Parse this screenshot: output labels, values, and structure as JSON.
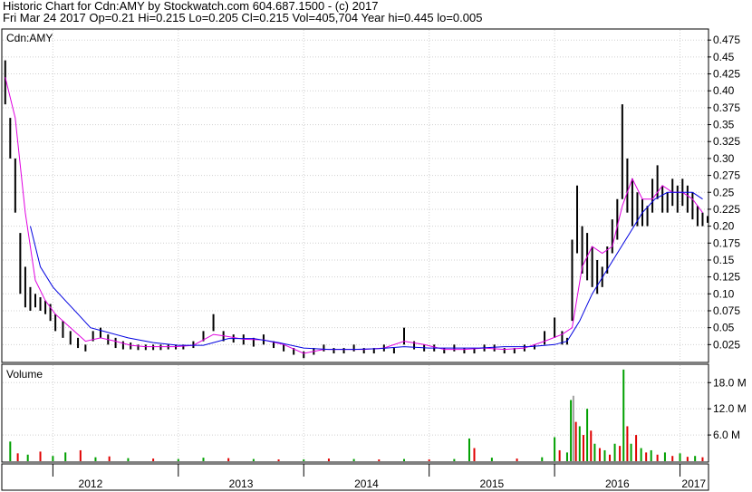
{
  "header": {
    "line1": "Historic Chart for Cdn:AMY by Stockwatch.com 604.687.1500 - (c) 2017",
    "line2": "Fri Mar 24 2017   Op=0.21  Hi=0.215  Lo=0.205  Cl=0.215  Vol=405,704   Year hi=0.445   lo=0.005"
  },
  "chart_data": [
    {
      "type": "line",
      "title": "Cdn:AMY",
      "xlim": [
        2011.6,
        2017.22
      ],
      "ylim": [
        0.0,
        0.49
      ],
      "y_ticks": [
        "0.475",
        "0.45",
        "0.425",
        "0.40",
        "0.375",
        "0.35",
        "0.325",
        "0.30",
        "0.275",
        "0.25",
        "0.225",
        "0.20",
        "0.175",
        "0.15",
        "0.125",
        "0.10",
        "0.075",
        "0.05",
        "0.025"
      ],
      "x_ticks": [
        "2012",
        "2013",
        "2014",
        "2015",
        "2016",
        "2017"
      ],
      "grid": true,
      "series": [
        {
          "style": "daily high-low bars",
          "color": "#000000",
          "x": [
            2011.62,
            2011.66,
            2011.7,
            2011.74,
            2011.78,
            2011.82,
            2011.86,
            2011.9,
            2011.94,
            2011.98,
            2012.02,
            2012.08,
            2012.14,
            2012.2,
            2012.26,
            2012.32,
            2012.38,
            2012.44,
            2012.5,
            2012.56,
            2012.62,
            2012.68,
            2012.74,
            2012.8,
            2012.86,
            2012.92,
            2012.98,
            2013.04,
            2013.12,
            2013.2,
            2013.28,
            2013.36,
            2013.44,
            2013.52,
            2013.6,
            2013.68,
            2013.76,
            2013.84,
            2013.92,
            2014.0,
            2014.08,
            2014.16,
            2014.24,
            2014.32,
            2014.4,
            2014.48,
            2014.56,
            2014.64,
            2014.72,
            2014.8,
            2014.88,
            2014.96,
            2015.04,
            2015.12,
            2015.2,
            2015.28,
            2015.36,
            2015.44,
            2015.52,
            2015.6,
            2015.68,
            2015.76,
            2015.84,
            2015.92,
            2016.0,
            2016.06,
            2016.1,
            2016.14,
            2016.18,
            2016.22,
            2016.26,
            2016.3,
            2016.34,
            2016.38,
            2016.42,
            2016.46,
            2016.5,
            2016.54,
            2016.58,
            2016.62,
            2016.66,
            2016.7,
            2016.74,
            2016.78,
            2016.82,
            2016.86,
            2016.9,
            2016.94,
            2016.98,
            2017.02,
            2017.06,
            2017.1,
            2017.14,
            2017.18,
            2017.22
          ],
          "high": [
            0.445,
            0.36,
            0.3,
            0.19,
            0.14,
            0.11,
            0.1,
            0.095,
            0.09,
            0.085,
            0.07,
            0.06,
            0.045,
            0.035,
            0.025,
            0.045,
            0.05,
            0.04,
            0.035,
            0.03,
            0.028,
            0.025,
            0.025,
            0.025,
            0.025,
            0.025,
            0.025,
            0.025,
            0.03,
            0.045,
            0.07,
            0.045,
            0.04,
            0.04,
            0.035,
            0.04,
            0.03,
            0.025,
            0.02,
            0.015,
            0.02,
            0.025,
            0.02,
            0.02,
            0.025,
            0.02,
            0.02,
            0.025,
            0.02,
            0.05,
            0.03,
            0.025,
            0.025,
            0.02,
            0.025,
            0.02,
            0.02,
            0.025,
            0.025,
            0.02,
            0.02,
            0.025,
            0.025,
            0.045,
            0.065,
            0.045,
            0.035,
            0.18,
            0.26,
            0.2,
            0.19,
            0.17,
            0.15,
            0.14,
            0.17,
            0.21,
            0.24,
            0.38,
            0.3,
            0.27,
            0.25,
            0.24,
            0.23,
            0.27,
            0.29,
            0.26,
            0.25,
            0.27,
            0.26,
            0.27,
            0.26,
            0.25,
            0.23,
            0.22,
            0.215
          ],
          "low": [
            0.38,
            0.3,
            0.22,
            0.1,
            0.08,
            0.075,
            0.08,
            0.075,
            0.07,
            0.06,
            0.045,
            0.035,
            0.025,
            0.02,
            0.015,
            0.03,
            0.035,
            0.025,
            0.02,
            0.018,
            0.018,
            0.017,
            0.017,
            0.017,
            0.017,
            0.018,
            0.018,
            0.018,
            0.02,
            0.03,
            0.045,
            0.03,
            0.028,
            0.025,
            0.022,
            0.025,
            0.02,
            0.015,
            0.01,
            0.005,
            0.01,
            0.015,
            0.012,
            0.012,
            0.015,
            0.012,
            0.012,
            0.015,
            0.012,
            0.025,
            0.018,
            0.015,
            0.015,
            0.012,
            0.015,
            0.012,
            0.012,
            0.015,
            0.015,
            0.012,
            0.012,
            0.015,
            0.018,
            0.025,
            0.035,
            0.025,
            0.025,
            0.06,
            0.16,
            0.13,
            0.12,
            0.11,
            0.1,
            0.11,
            0.13,
            0.16,
            0.18,
            0.24,
            0.22,
            0.2,
            0.2,
            0.2,
            0.2,
            0.22,
            0.24,
            0.22,
            0.22,
            0.23,
            0.22,
            0.23,
            0.22,
            0.21,
            0.2,
            0.2,
            0.205
          ]
        },
        {
          "style": "short moving average",
          "color": "#e000e0",
          "x": [
            2011.62,
            2011.7,
            2011.78,
            2011.86,
            2011.94,
            2012.02,
            2012.14,
            2012.26,
            2012.38,
            2012.5,
            2012.62,
            2012.74,
            2012.86,
            2012.98,
            2013.12,
            2013.28,
            2013.36,
            2013.52,
            2013.68,
            2013.84,
            2014.0,
            2014.16,
            2014.32,
            2014.48,
            2014.64,
            2014.8,
            2014.96,
            2015.12,
            2015.28,
            2015.44,
            2015.6,
            2015.76,
            2015.92,
            2016.06,
            2016.14,
            2016.22,
            2016.3,
            2016.38,
            2016.46,
            2016.54,
            2016.62,
            2016.7,
            2016.78,
            2016.86,
            2016.94,
            2017.02,
            2017.1,
            2017.18
          ],
          "values": [
            0.42,
            0.36,
            0.22,
            0.12,
            0.09,
            0.07,
            0.05,
            0.03,
            0.035,
            0.03,
            0.024,
            0.022,
            0.022,
            0.022,
            0.024,
            0.04,
            0.038,
            0.033,
            0.032,
            0.025,
            0.012,
            0.018,
            0.018,
            0.018,
            0.02,
            0.03,
            0.025,
            0.018,
            0.018,
            0.02,
            0.018,
            0.02,
            0.03,
            0.04,
            0.05,
            0.14,
            0.17,
            0.16,
            0.17,
            0.23,
            0.27,
            0.24,
            0.24,
            0.26,
            0.25,
            0.25,
            0.24,
            0.22
          ]
        },
        {
          "style": "long moving average",
          "color": "#0000e0",
          "x": [
            2011.82,
            2011.9,
            2012.0,
            2012.1,
            2012.2,
            2012.3,
            2012.4,
            2012.6,
            2012.8,
            2013.0,
            2013.2,
            2013.4,
            2013.6,
            2013.8,
            2014.0,
            2014.2,
            2014.4,
            2014.6,
            2014.8,
            2015.0,
            2015.2,
            2015.4,
            2015.6,
            2015.8,
            2016.0,
            2016.1,
            2016.2,
            2016.3,
            2016.4,
            2016.5,
            2016.6,
            2016.7,
            2016.8,
            2016.9,
            2017.0,
            2017.1,
            2017.18
          ],
          "values": [
            0.2,
            0.14,
            0.11,
            0.09,
            0.07,
            0.05,
            0.045,
            0.035,
            0.028,
            0.024,
            0.024,
            0.034,
            0.034,
            0.028,
            0.02,
            0.018,
            0.018,
            0.019,
            0.022,
            0.02,
            0.02,
            0.02,
            0.022,
            0.022,
            0.025,
            0.03,
            0.06,
            0.1,
            0.13,
            0.16,
            0.19,
            0.22,
            0.24,
            0.25,
            0.25,
            0.25,
            0.24
          ]
        }
      ]
    },
    {
      "type": "bar",
      "title": "Volume",
      "ylim": [
        0,
        22000000
      ],
      "y_ticks": [
        "18.0 M",
        "12.0 M",
        "6.0 M"
      ],
      "grid": true,
      "up_color": "#00a000",
      "down_color": "#e00000",
      "flat_color": "#a0a0a0",
      "bars": [
        [
          2011.66,
          4500000,
          "u"
        ],
        [
          2011.72,
          1800000,
          "d"
        ],
        [
          2011.8,
          1500000,
          "u"
        ],
        [
          2011.9,
          2200000,
          "d"
        ],
        [
          2012.0,
          1200000,
          "u"
        ],
        [
          2012.1,
          2000000,
          "u"
        ],
        [
          2012.22,
          2500000,
          "d"
        ],
        [
          2012.34,
          900000,
          "u"
        ],
        [
          2012.45,
          1100000,
          "d"
        ],
        [
          2012.6,
          700000,
          "u"
        ],
        [
          2012.8,
          600000,
          "d"
        ],
        [
          2013.0,
          500000,
          "u"
        ],
        [
          2013.2,
          800000,
          "u"
        ],
        [
          2013.4,
          700000,
          "d"
        ],
        [
          2013.6,
          500000,
          "u"
        ],
        [
          2013.8,
          400000,
          "d"
        ],
        [
          2014.0,
          400000,
          "u"
        ],
        [
          2014.2,
          600000,
          "d"
        ],
        [
          2014.4,
          500000,
          "u"
        ],
        [
          2014.6,
          400000,
          "d"
        ],
        [
          2014.8,
          500000,
          "u"
        ],
        [
          2015.0,
          400000,
          "d"
        ],
        [
          2015.2,
          500000,
          "u"
        ],
        [
          2015.32,
          5200000,
          "u"
        ],
        [
          2015.36,
          3000000,
          "d"
        ],
        [
          2015.5,
          800000,
          "u"
        ],
        [
          2015.7,
          600000,
          "d"
        ],
        [
          2015.9,
          900000,
          "u"
        ],
        [
          2016.0,
          5500000,
          "u"
        ],
        [
          2016.04,
          2500000,
          "d"
        ],
        [
          2016.1,
          2000000,
          "u"
        ],
        [
          2016.13,
          14000000,
          "u"
        ],
        [
          2016.15,
          15000000,
          "f"
        ],
        [
          2016.17,
          9000000,
          "d"
        ],
        [
          2016.2,
          8000000,
          "u"
        ],
        [
          2016.23,
          6000000,
          "d"
        ],
        [
          2016.26,
          12000000,
          "u"
        ],
        [
          2016.29,
          7000000,
          "d"
        ],
        [
          2016.32,
          4000000,
          "u"
        ],
        [
          2016.36,
          3000000,
          "d"
        ],
        [
          2016.4,
          2500000,
          "u"
        ],
        [
          2016.44,
          1500000,
          "d"
        ],
        [
          2016.48,
          4000000,
          "u"
        ],
        [
          2016.52,
          3500000,
          "d"
        ],
        [
          2016.55,
          21000000,
          "u"
        ],
        [
          2016.58,
          8000000,
          "d"
        ],
        [
          2016.61,
          4000000,
          "u"
        ],
        [
          2016.65,
          6000000,
          "d"
        ],
        [
          2016.69,
          3000000,
          "u"
        ],
        [
          2016.73,
          2000000,
          "d"
        ],
        [
          2016.77,
          2500000,
          "u"
        ],
        [
          2016.82,
          1500000,
          "d"
        ],
        [
          2016.88,
          2000000,
          "u"
        ],
        [
          2016.94,
          1200000,
          "d"
        ],
        [
          2017.0,
          1800000,
          "u"
        ],
        [
          2017.06,
          1000000,
          "d"
        ],
        [
          2017.12,
          1200000,
          "u"
        ],
        [
          2017.18,
          900000,
          "d"
        ]
      ]
    }
  ]
}
